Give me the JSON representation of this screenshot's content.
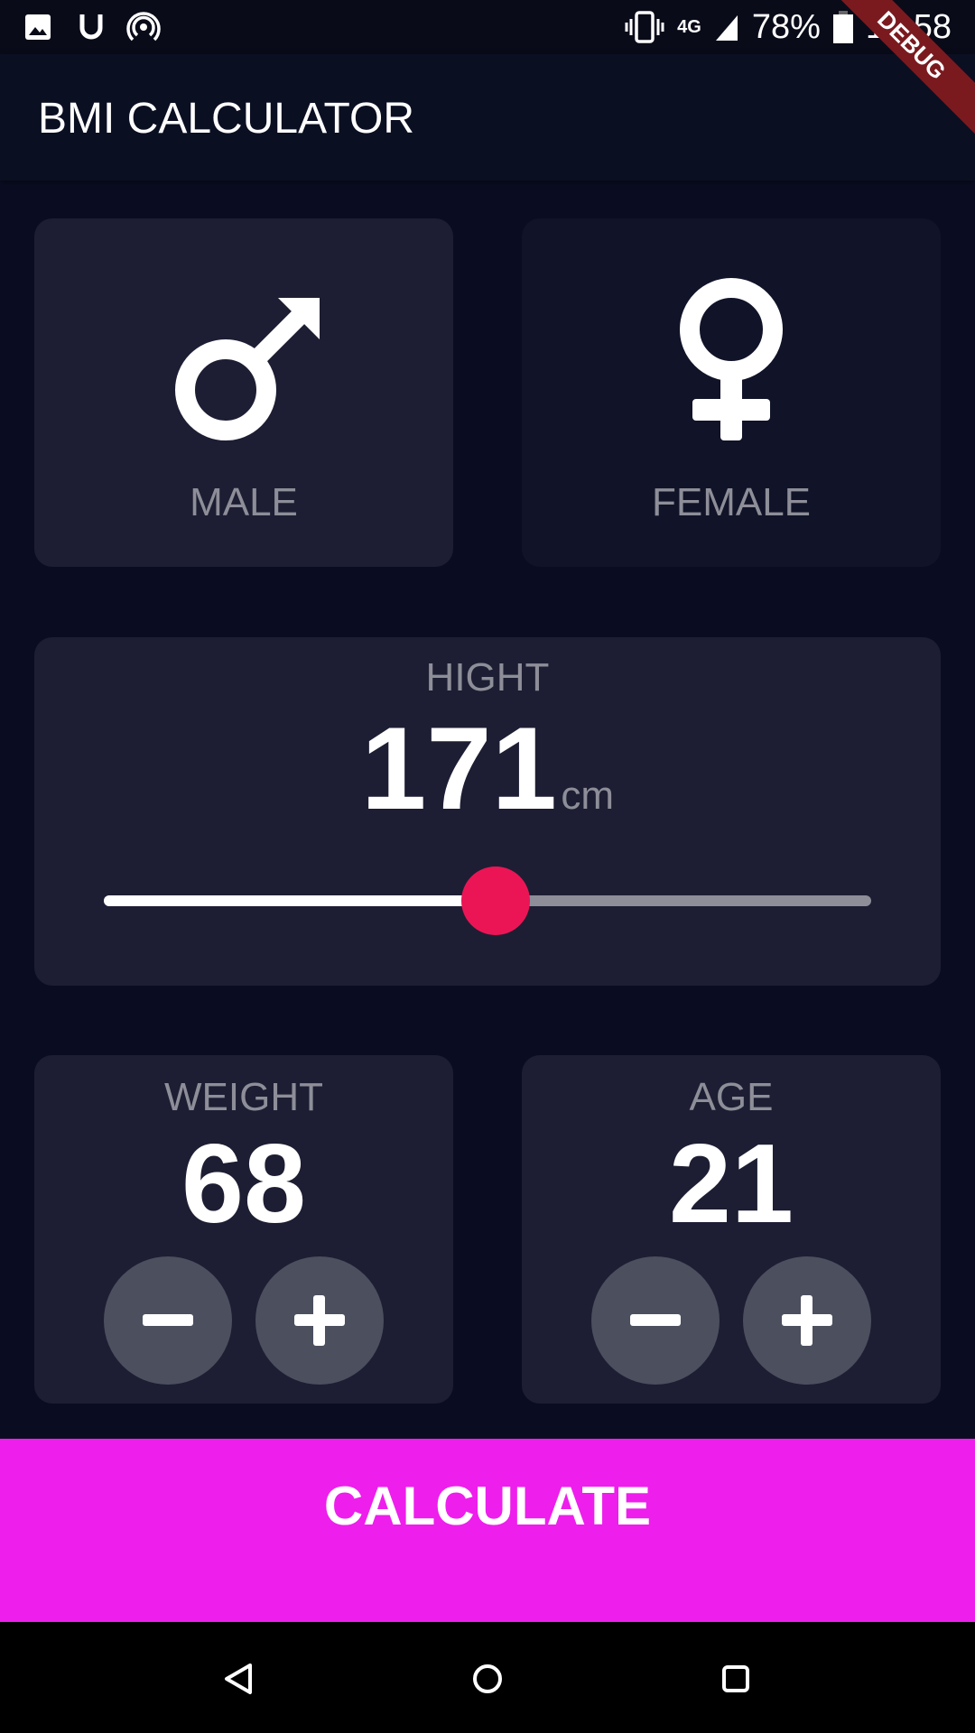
{
  "status_bar": {
    "battery": "78%",
    "time": "12:58",
    "network": "4G"
  },
  "debug_banner": "DEBUG",
  "app_bar": {
    "title": "BMI CALCULATOR"
  },
  "gender": {
    "male": "MALE",
    "female": "FEMALE",
    "selected": "male"
  },
  "height": {
    "label": "HIGHT",
    "value": "171",
    "unit": "cm",
    "min": 120,
    "max": 220
  },
  "weight": {
    "label": "WEIGHT",
    "value": "68"
  },
  "age": {
    "label": "AGE",
    "value": "21"
  },
  "calculate_label": "CALCULATE",
  "colors": {
    "accent": "#eb1555",
    "button": "#ee1eec",
    "card_active": "#1d1e33",
    "card_inactive": "#111328"
  }
}
